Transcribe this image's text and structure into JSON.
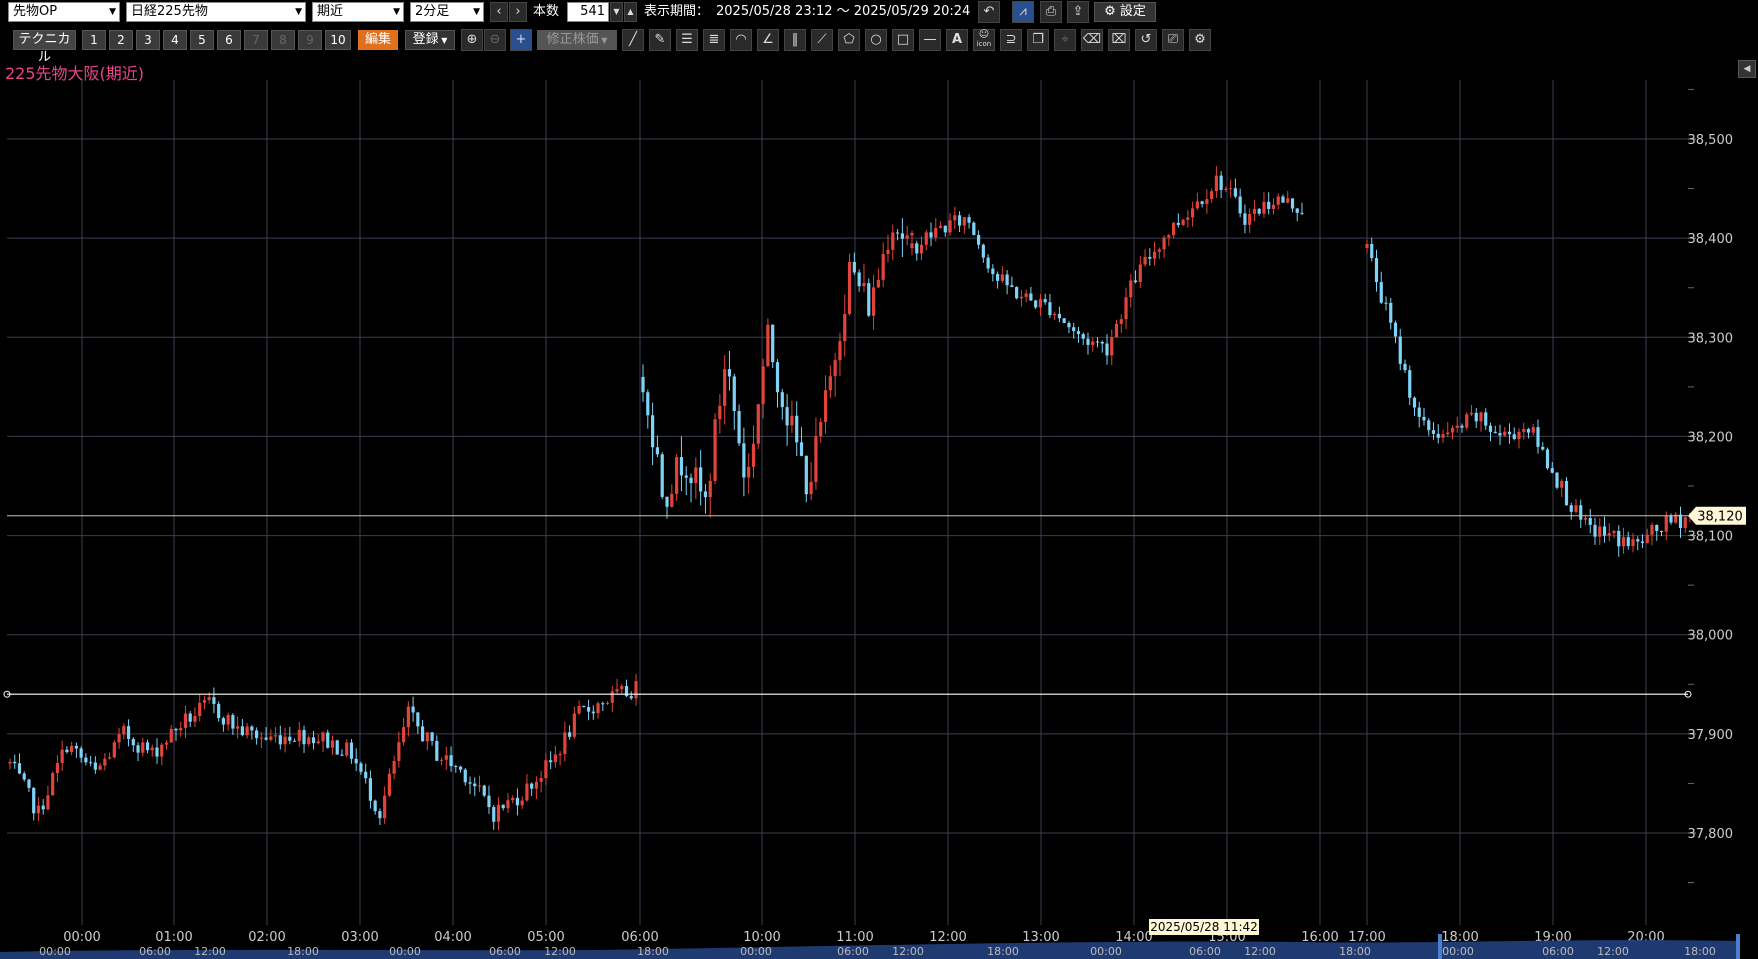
{
  "toolbar": {
    "market_select": "先物OP",
    "symbol_select": "日経225先物",
    "contract_select": "期近",
    "interval_select": "2分足",
    "count_label": "本数",
    "count_value": "541",
    "period_label": "表示期間：",
    "period_value": "2025/05/28 23:12 ～ 2025/05/29 20:24",
    "settings_label": "設定",
    "technical_label": "テクニカル",
    "number_buttons": [
      "1",
      "2",
      "3",
      "4",
      "5",
      "6",
      "7",
      "8",
      "9",
      "10"
    ],
    "edit_label": "編集",
    "register_label": "登録",
    "adjusted_label": "修正株価",
    "icon_text": "icon"
  },
  "chart_title": "225先物大阪(期近)",
  "colors": {
    "up": "#e0443a",
    "down": "#7fd3f7",
    "grid": "#3a3f52",
    "title": "#e8458b",
    "badge": "#fff7d6"
  },
  "chart_data": {
    "type": "candlestick",
    "title": "225先物大阪(期近)",
    "ylim": [
      37700,
      38550
    ],
    "y_ticks": [
      37800,
      37900,
      38000,
      38100,
      38200,
      38300,
      38400,
      38500
    ],
    "y_tick_labels": [
      "37,800",
      "37,900",
      "38,000",
      "38,100",
      "38,200",
      "38,300",
      "38,400",
      "38,500"
    ],
    "current_price": 38120,
    "current_price_label": "38,120",
    "horizontal_line": 37940,
    "x_tick_labels": [
      "00:00",
      "01:00",
      "02:00",
      "03:00",
      "04:00",
      "05:00",
      "06:00",
      "10:00",
      "11:00",
      "12:00",
      "13:00",
      "14:00",
      "15:00",
      "16:00",
      "17:00",
      "18:00",
      "19:00",
      "20:00"
    ],
    "cursor_label": "2025/05/28 11:42",
    "navigator_labels": [
      "00:00",
      "06:00",
      "12:00",
      "18:00",
      "00:00",
      "06:00",
      "12:00",
      "18:00",
      "00:00",
      "06:00",
      "12:00",
      "18:00",
      "00:00",
      "06:00",
      "12:00",
      "18:00",
      "00:00",
      "06:00",
      "12:00",
      "18:00"
    ],
    "segments": [
      {
        "session": "night",
        "x_range": [
          "00:00",
          "06:00"
        ],
        "open": 37870,
        "anchors": [
          37870,
          37820,
          37890,
          37860,
          37900,
          37880,
          37910,
          37930,
          37905,
          37895,
          37900,
          37895,
          37880,
          37820,
          37920,
          37880,
          37860,
          37820,
          37840,
          37870,
          37920,
          37935,
          37945
        ]
      },
      {
        "session": "day-am",
        "x_range": [
          "10:00",
          "11:30"
        ],
        "open": 38260,
        "anchors": [
          38260,
          38140,
          38180,
          38130,
          38280,
          38150,
          38300,
          38220,
          38150,
          38250,
          38370,
          38330,
          38420,
          38390
        ]
      },
      {
        "session": "day-mid",
        "x_range": [
          "11:30",
          "15:45"
        ],
        "open": 38390,
        "anchors": [
          38390,
          38410,
          38420,
          38360,
          38340,
          38330,
          38300,
          38290,
          38360,
          38400,
          38430,
          38460,
          38420,
          38440,
          38430
        ]
      },
      {
        "session": "evening",
        "x_range": [
          "17:00",
          "20:24"
        ],
        "open": 38390,
        "anchors": [
          38390,
          38300,
          38210,
          38200,
          38220,
          38200,
          38210,
          38160,
          38110,
          38100,
          38090,
          38110,
          38120
        ]
      }
    ]
  }
}
